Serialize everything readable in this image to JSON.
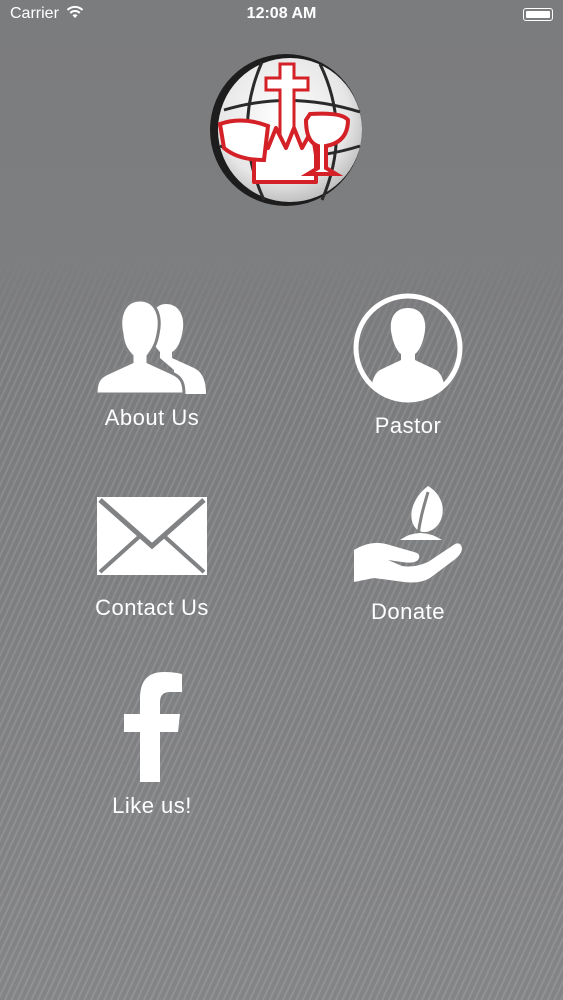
{
  "status_bar": {
    "carrier": "Carrier",
    "time": "12:08 AM"
  },
  "logo": {
    "icon": "church-cross-crown-globe-logo"
  },
  "menu": {
    "about": {
      "label": "About Us",
      "icon": "users-icon"
    },
    "pastor": {
      "label": "Pastor",
      "icon": "person-circle-icon"
    },
    "contact": {
      "label": "Contact Us",
      "icon": "envelope-icon"
    },
    "donate": {
      "label": "Donate",
      "icon": "hand-plant-icon"
    },
    "facebook": {
      "label": "Like us!",
      "icon": "facebook-icon"
    }
  },
  "colors": {
    "background": "#818284",
    "logo_red": "#d42027",
    "icon_fg": "#ffffff"
  }
}
